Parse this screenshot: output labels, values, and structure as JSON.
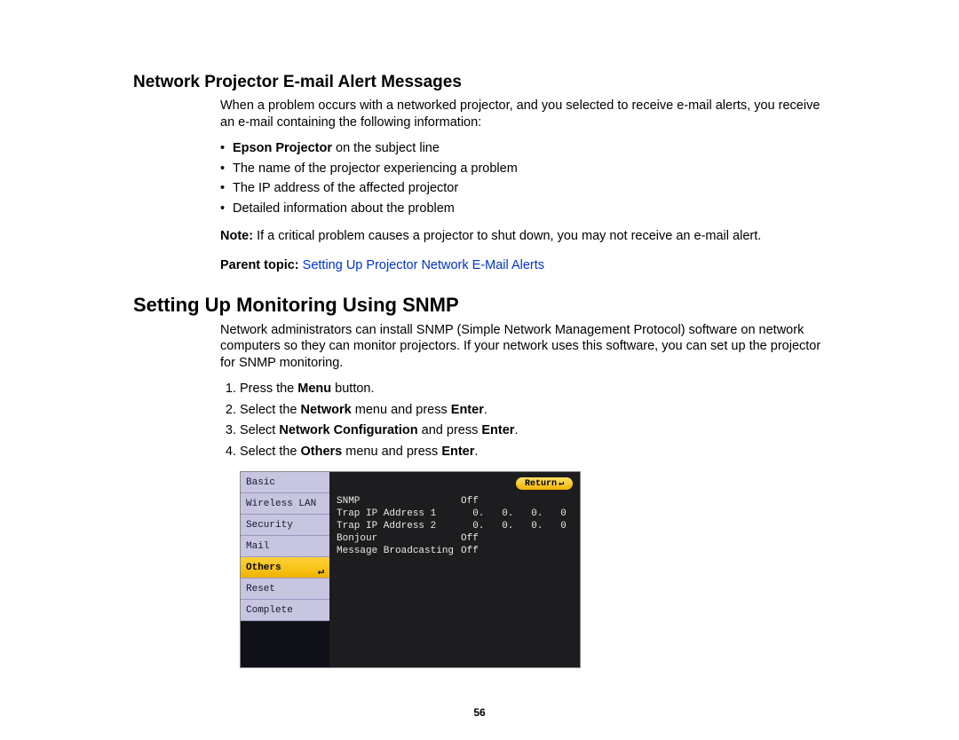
{
  "section1": {
    "title": "Network Projector E-mail Alert Messages",
    "intro": "When a problem occurs with a networked projector, and you selected to receive e-mail alerts, you receive an e-mail containing the following information:",
    "bullet1_bold": "Epson Projector",
    "bullet1_rest": " on the subject line",
    "bullet2": "The name of the projector experiencing a problem",
    "bullet3": "The IP address of the affected projector",
    "bullet4": "Detailed information about the problem",
    "note_label": "Note:",
    "note_body": " If a critical problem causes a projector to shut down, you may not receive an e-mail alert.",
    "parent_label": "Parent topic:",
    "parent_link": "Setting Up Projector Network E-Mail Alerts"
  },
  "section2": {
    "title": "Setting Up Monitoring Using SNMP",
    "intro": "Network administrators can install SNMP (Simple Network Management Protocol) software on network computers so they can monitor projectors. If your network uses this software, you can set up the projector for SNMP monitoring.",
    "step1_a": "Press the ",
    "step1_b": "Menu",
    "step1_c": " button.",
    "step2_a": "Select the ",
    "step2_b": "Network",
    "step2_c": " menu and press ",
    "step2_d": "Enter",
    "step2_e": ".",
    "step3_a": "Select ",
    "step3_b": "Network Configuration",
    "step3_c": " and press ",
    "step3_d": "Enter",
    "step3_e": ".",
    "step4_a": "Select the ",
    "step4_b": "Others",
    "step4_c": " menu and press ",
    "step4_d": "Enter",
    "step4_e": "."
  },
  "menu": {
    "sidebar": {
      "items": [
        {
          "label": "Basic"
        },
        {
          "label": "Wireless LAN"
        },
        {
          "label": "Security"
        },
        {
          "label": "Mail"
        },
        {
          "label": "Others"
        },
        {
          "label": "Reset"
        },
        {
          "label": "Complete"
        }
      ]
    },
    "return_label": "Return",
    "rows": [
      {
        "label": "SNMP",
        "value": "Off"
      },
      {
        "label": "Trap IP Address 1",
        "value": "  0.   0.   0.   0"
      },
      {
        "label": "Trap IP Address 2",
        "value": "  0.   0.   0.   0"
      },
      {
        "label": "Bonjour",
        "value": "Off"
      },
      {
        "label": "Message Broadcasting",
        "value": "Off"
      }
    ]
  },
  "page_number": "56"
}
